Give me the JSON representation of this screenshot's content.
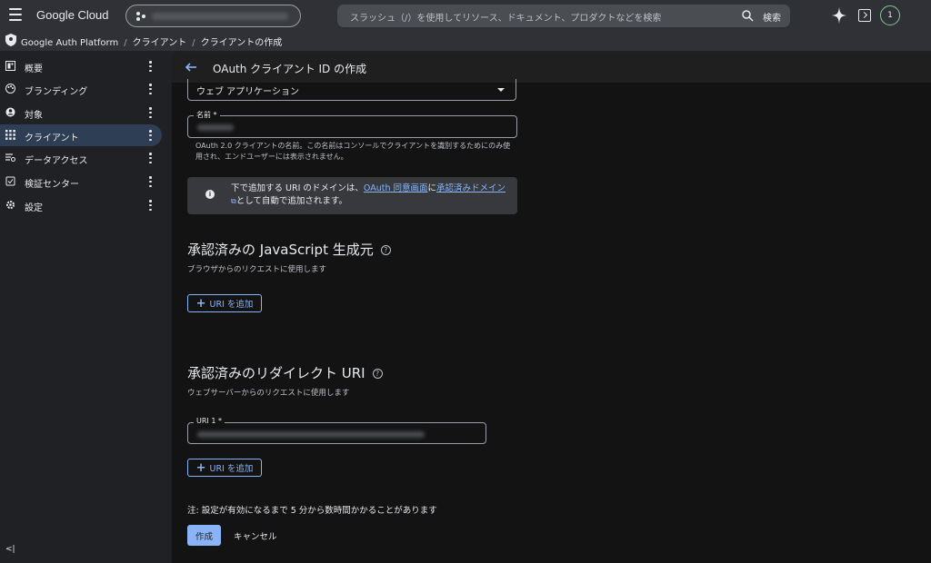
{
  "header": {
    "logo": "Google Cloud",
    "search_placeholder": "スラッシュ（/）を使用してリソース、ドキュメント、プロダクトなどを検索",
    "search_label": "検索",
    "avatar_initial": "1"
  },
  "breadcrumb": {
    "items": [
      "Google Auth Platform",
      "クライアント",
      "クライアントの作成"
    ],
    "separator": "/"
  },
  "sidebar": {
    "items": [
      {
        "label": "概要",
        "icon": "dashboard-icon",
        "active": false
      },
      {
        "label": "ブランディング",
        "icon": "palette-icon",
        "active": false
      },
      {
        "label": "対象",
        "icon": "account-circle-icon",
        "active": false
      },
      {
        "label": "クライアント",
        "icon": "apps-grid-icon",
        "active": true
      },
      {
        "label": "データアクセス",
        "icon": "data-access-icon",
        "active": false
      },
      {
        "label": "検証センター",
        "icon": "verification-icon",
        "active": false
      },
      {
        "label": "設定",
        "icon": "gear-icon",
        "active": false
      }
    ],
    "collapse_label": "<|"
  },
  "page": {
    "title": "OAuth クライアント ID の作成",
    "app_type_value": "ウェブ アプリケーション",
    "name_label": "名前 *",
    "name_helper": "OAuth 2.0 クライアントの名前。この名前はコンソールでクライアントを識別するためにのみ使用され、エンドユーザーには表示されません。",
    "info": {
      "prefix": "下で追加する URI のドメインは、",
      "link1": "OAuth 同意画面",
      "middle": "に",
      "link2": "承認済みドメイン",
      "suffix": "として自動で追加されます。"
    },
    "js_origins": {
      "title": "承認済みの JavaScript 生成元",
      "desc": "ブラウザからのリクエストに使用します",
      "add_label": "URI を追加"
    },
    "redirect_uris": {
      "title": "承認済みのリダイレクト URI",
      "desc": "ウェブサーバーからのリクエストに使用します",
      "uri_label": "URI 1 *",
      "add_label": "URI を追加"
    },
    "note": "注: 設定が有効になるまで 5 分から数時間かかることがあります",
    "create_label": "作成",
    "cancel_label": "キャンセル"
  },
  "colors": {
    "accent": "#8ab4f8",
    "active_nav": "#2d3e55",
    "avatar_ring": "#81c995"
  }
}
